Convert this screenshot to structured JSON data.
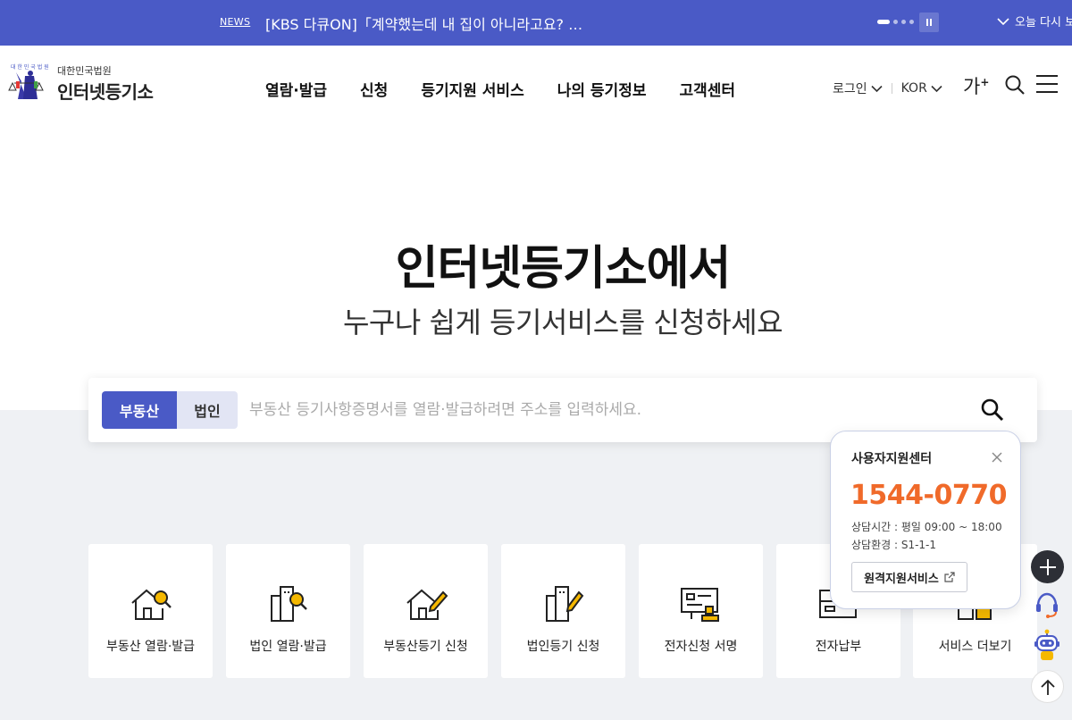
{
  "news": {
    "tag": "NEWS",
    "headline": "[KBS 다큐ON]「계약했는데 내 집이 아니라고요? …",
    "today_close": "오늘 다시 보"
  },
  "header": {
    "logo_sub": "대한민국법원",
    "logo_title": "인터넷등기소",
    "nav": [
      "열람·발급",
      "신청",
      "등기지원 서비스",
      "나의 등기정보",
      "고객센터"
    ],
    "login": "로그인",
    "language": "KOR",
    "font_size_label": "가",
    "font_size_plus": "+"
  },
  "hero": {
    "title": "인터넷등기소에서",
    "subtitle": "누구나 쉽게 등기서비스를 신청하세요"
  },
  "search": {
    "tabs": [
      "부동산",
      "법인"
    ],
    "active_tab": "부동산",
    "placeholder": "부동산 등기사항증명서를 열람·발급하려면 주소를 입력하세요.",
    "value": ""
  },
  "quick_menu": [
    {
      "label": "부동산 열람·발급",
      "icon": "house-search-icon"
    },
    {
      "label": "법인 열람·발급",
      "icon": "building-search-icon"
    },
    {
      "label": "부동산등기 신청",
      "icon": "house-pencil-icon"
    },
    {
      "label": "법인등기 신청",
      "icon": "building-pencil-icon"
    },
    {
      "label": "전자신청 서명",
      "icon": "monitor-seal-icon"
    },
    {
      "label": "전자납부",
      "icon": "card-payment-icon"
    },
    {
      "label": "서비스 더보기",
      "icon": "more-services-icon"
    }
  ],
  "support": {
    "title": "사용자지원센터",
    "phone": "1544-0770",
    "hours": "상담시간 : 평일 09:00 ~ 18:00",
    "env": "상담환경 : S1-1-1",
    "remote_label": "원격지원서비스"
  },
  "colors": {
    "brand": "#4a5ac6",
    "accent": "#f06a2a",
    "icon_yellow": "#f5b800"
  }
}
